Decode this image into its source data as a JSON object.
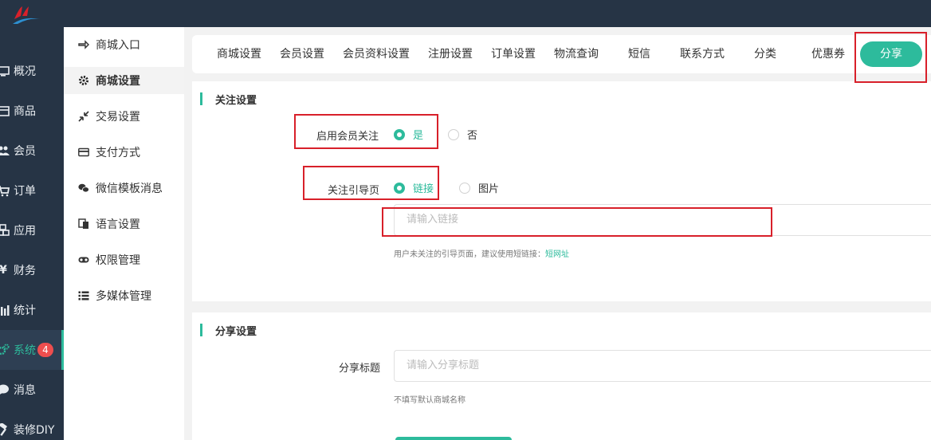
{
  "colors": {
    "accent": "#2dbb9c",
    "sidebar_bg": "#263445",
    "badge": "#ee4e4e",
    "annotation": "#d8202a"
  },
  "sidebar": {
    "items": [
      {
        "label": "概况",
        "icon": "monitor-icon"
      },
      {
        "label": "商品",
        "icon": "box-icon"
      },
      {
        "label": "会员",
        "icon": "users-icon"
      },
      {
        "label": "订单",
        "icon": "cart-icon"
      },
      {
        "label": "应用",
        "icon": "cubes-icon"
      },
      {
        "label": "财务",
        "icon": "yen-icon"
      },
      {
        "label": "统计",
        "icon": "bar-chart-icon"
      },
      {
        "label": "系统",
        "icon": "gears-icon",
        "active": true
      },
      {
        "label": "消息",
        "icon": "chat-icon",
        "badge": "4"
      },
      {
        "label": "装修DIY",
        "icon": "hammer-icon"
      }
    ]
  },
  "submenu": {
    "items": [
      {
        "label": "商城入口",
        "icon": "hand-pointer-icon"
      },
      {
        "label": "商城设置",
        "icon": "gear-icon",
        "active": true
      },
      {
        "label": "交易设置",
        "icon": "compress-icon"
      },
      {
        "label": "支付方式",
        "icon": "credit-card-icon"
      },
      {
        "label": "微信模板消息",
        "icon": "wechat-icon"
      },
      {
        "label": "语言设置",
        "icon": "language-icon"
      },
      {
        "label": "权限管理",
        "icon": "mask-icon"
      },
      {
        "label": "多媒体管理",
        "icon": "list-icon"
      }
    ]
  },
  "tabs": {
    "items": [
      "商城设置",
      "会员设置",
      "会员资料设置",
      "注册设置",
      "订单设置",
      "物流查询",
      "短信",
      "联系方式",
      "分类",
      "优惠券"
    ],
    "active": "分享"
  },
  "follow": {
    "title": "关注设置",
    "enable_label": "启用会员关注",
    "enable_yes": "是",
    "enable_no": "否",
    "guide_label": "关注引导页",
    "guide_link": "链接",
    "guide_image": "图片",
    "link_placeholder": "请输入链接",
    "hint": "用户未关注的引导页面，建议使用短链接：",
    "hint_link": "短网址"
  },
  "share": {
    "title": "分享设置",
    "title_label": "分享标题",
    "title_placeholder": "请输入分享标题",
    "hint": "不填写默认商城名称"
  }
}
